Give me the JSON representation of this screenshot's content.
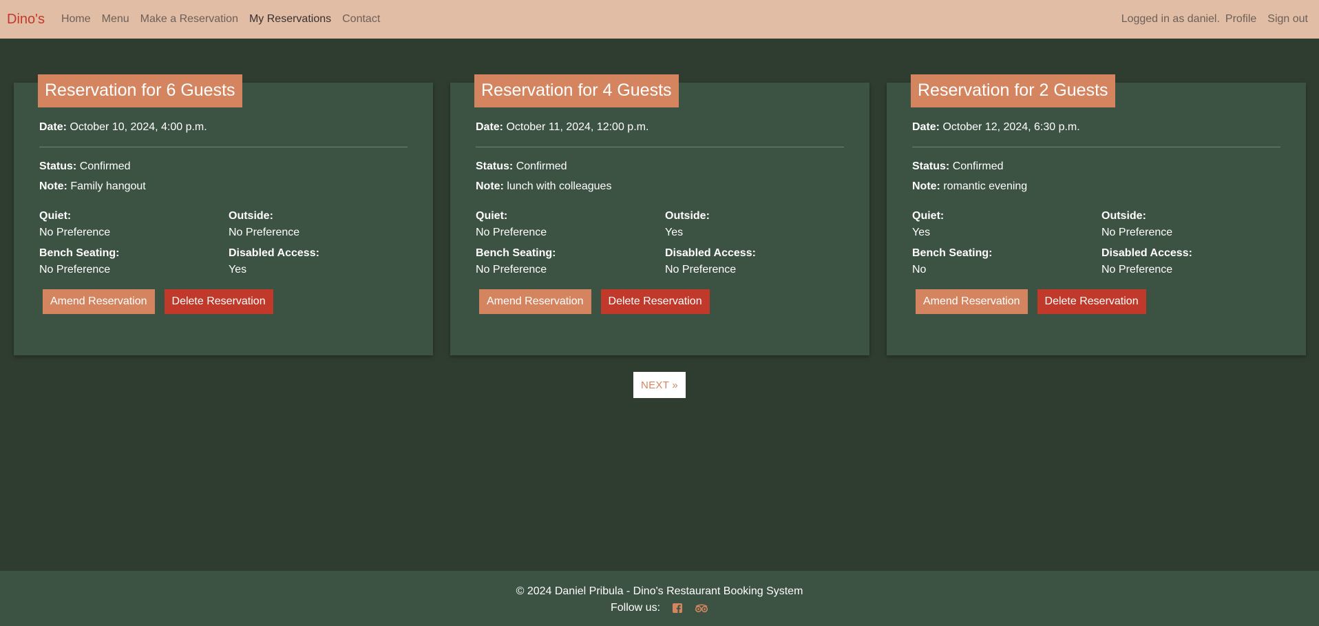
{
  "navbar": {
    "brand": "Dino's",
    "links": [
      "Home",
      "Menu",
      "Make a Reservation",
      "My Reservations",
      "Contact"
    ],
    "active_link": "My Reservations",
    "logged_in_text": "Logged in as daniel.",
    "profile_label": "Profile",
    "signout_label": "Sign out"
  },
  "labels": {
    "date": "Date:",
    "status": "Status:",
    "note": "Note:",
    "quiet": "Quiet:",
    "outside": "Outside:",
    "bench": "Bench Seating:",
    "disabled": "Disabled Access:",
    "amend": "Amend Reservation",
    "delete": "Delete Reservation"
  },
  "reservations": [
    {
      "title": "Reservation for 6 Guests",
      "date": "October 10, 2024, 4:00 p.m.",
      "status": "Confirmed",
      "note": "Family hangout",
      "quiet": "No Preference",
      "outside": "No Preference",
      "bench": "No Preference",
      "disabled": "Yes"
    },
    {
      "title": "Reservation for 4 Guests",
      "date": "October 11, 2024, 12:00 p.m.",
      "status": "Confirmed",
      "note": "lunch with colleagues",
      "quiet": "No Preference",
      "outside": "Yes",
      "bench": "No Preference",
      "disabled": "No Preference"
    },
    {
      "title": "Reservation for 2 Guests",
      "date": "October 12, 2024, 6:30 p.m.",
      "status": "Confirmed",
      "note": "romantic evening",
      "quiet": "Yes",
      "outside": "No Preference",
      "bench": "No",
      "disabled": "No Preference"
    }
  ],
  "pagination": {
    "next_label": "NEXT »"
  },
  "footer": {
    "copyright": "© 2024 Daniel Pribula - Dino's Restaurant Booking System",
    "follow_label": "Follow us:",
    "social_icons": [
      "facebook-icon",
      "tripadvisor-icon"
    ]
  },
  "colors": {
    "background": "#2f3d30",
    "navbar": "#e0bda4",
    "card": "#3c5243",
    "accent": "#d48560",
    "danger": "#c0392b",
    "brand": "#c0392b"
  }
}
